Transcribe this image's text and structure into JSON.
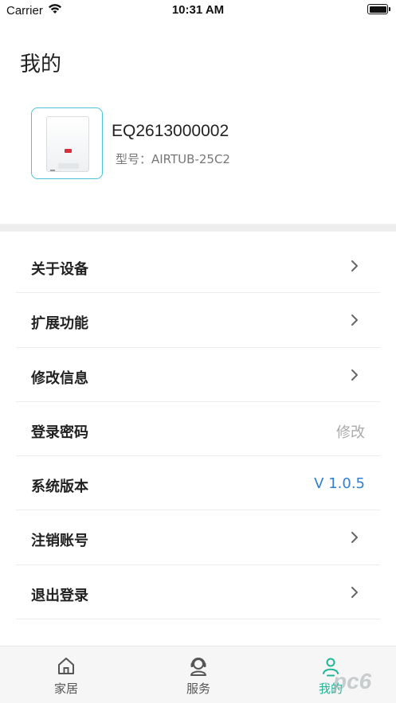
{
  "status_bar": {
    "carrier": "Carrier",
    "time": "10:31 AM",
    "icons": [
      "wifi-icon",
      "battery-icon"
    ]
  },
  "page": {
    "title": "我的"
  },
  "device": {
    "name": "EQ2613000002",
    "model": "型号：AIRTUB-25C2"
  },
  "menu": {
    "items": [
      {
        "label": "关于设备",
        "value": "",
        "icon": "chevron-right-icon"
      },
      {
        "label": "扩展功能",
        "value": "",
        "icon": "chevron-right-icon"
      },
      {
        "label": "修改信息",
        "value": "",
        "icon": "chevron-right-icon"
      },
      {
        "label": "登录密码",
        "value": "修改",
        "icon": ""
      },
      {
        "label": "系统版本",
        "value": "V 1.0.5",
        "icon": ""
      },
      {
        "label": "注销账号",
        "value": "",
        "icon": "chevron-right-icon"
      },
      {
        "label": "退出登录",
        "value": "",
        "icon": "chevron-right-icon"
      }
    ]
  },
  "tab_bar": {
    "tabs": [
      {
        "label": "家居",
        "icon": "home-icon",
        "active": false
      },
      {
        "label": "服务",
        "icon": "customer-service-icon",
        "active": false
      },
      {
        "label": "我的",
        "icon": "user-icon",
        "active": true
      }
    ]
  },
  "watermark": {
    "text": "pc6"
  },
  "colors": {
    "accent": "#20b596",
    "version_text": "#2f7fd6",
    "thumb_border": "#4fc3d6",
    "divider": "#eeeeee"
  }
}
